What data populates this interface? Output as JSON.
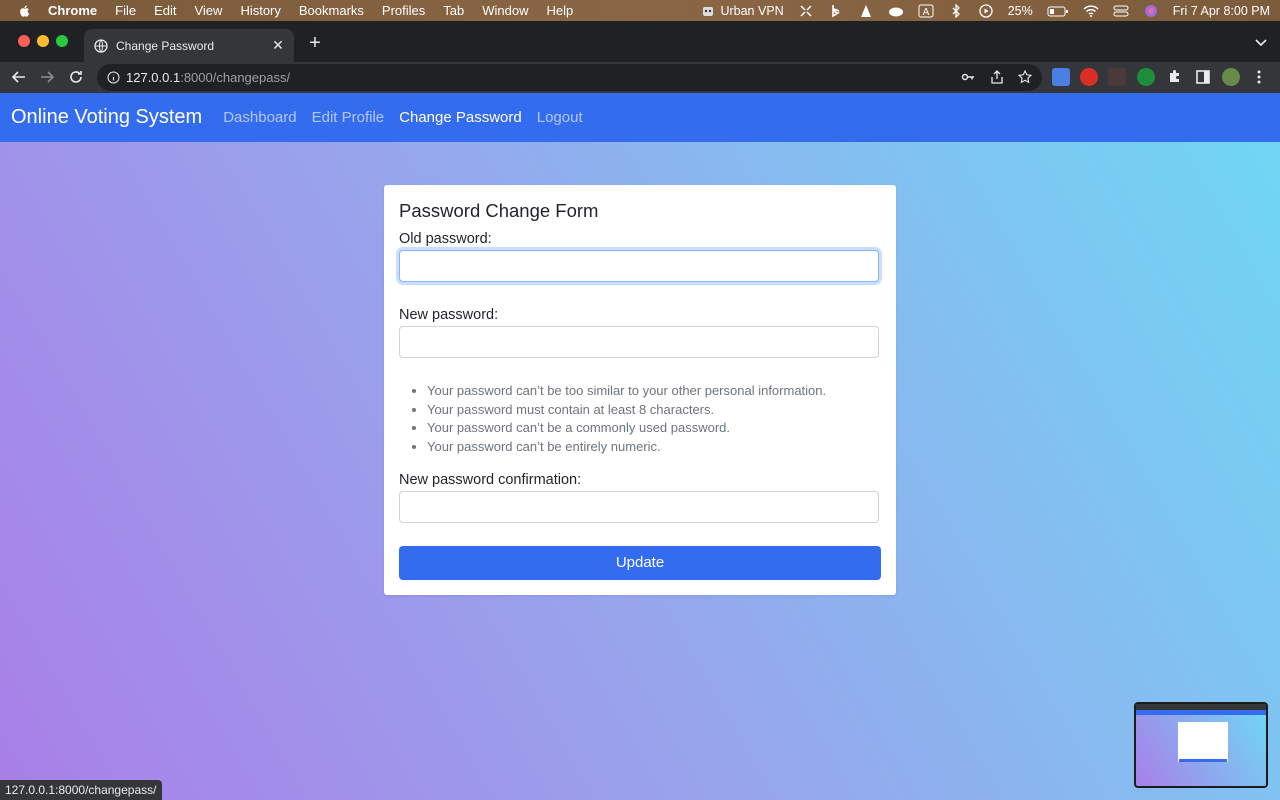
{
  "menubar": {
    "app": "Chrome",
    "items": [
      "File",
      "Edit",
      "View",
      "History",
      "Bookmarks",
      "Profiles",
      "Tab",
      "Window",
      "Help"
    ],
    "vpn": "Urban VPN",
    "battery": "25%",
    "datetime": "Fri 7 Apr  8:00 PM"
  },
  "browser": {
    "tab_title": "Change Password",
    "url_host": "127.0.0.1",
    "url_path": ":8000/changepass/",
    "status_url": "127.0.0.1:8000/changepass/"
  },
  "navbar": {
    "brand": "Online Voting System",
    "links": [
      "Dashboard",
      "Edit Profile",
      "Change Password",
      "Logout"
    ],
    "active": "Change Password",
    "color": "#346cf0"
  },
  "form": {
    "title": "Password Change Form",
    "old_label": "Old password:",
    "old_value": "",
    "new_label": "New password:",
    "new_value": "",
    "help": [
      "Your password can’t be too similar to your other personal information.",
      "Your password must contain at least 8 characters.",
      "Your password can’t be a commonly used password.",
      "Your password can’t be entirely numeric."
    ],
    "confirm_label": "New password confirmation:",
    "confirm_value": "",
    "submit": "Update"
  }
}
